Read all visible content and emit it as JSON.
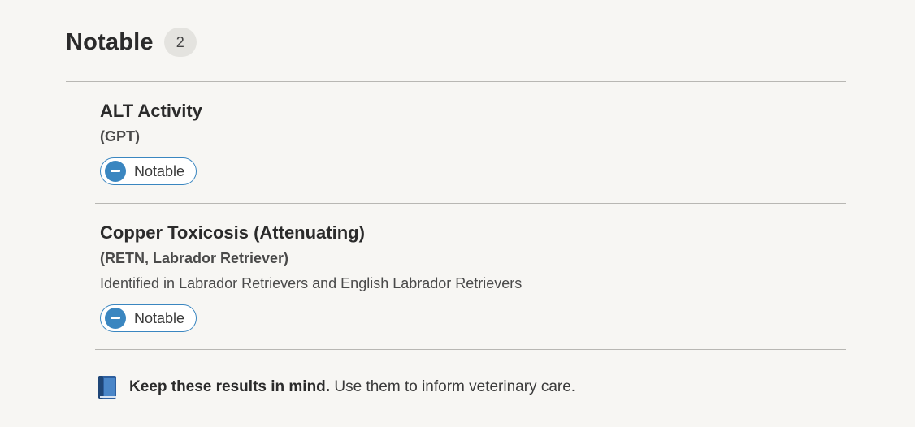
{
  "section": {
    "title": "Notable",
    "count": "2"
  },
  "results": [
    {
      "title": "ALT Activity",
      "subtitle": "(GPT)",
      "status_label": "Notable",
      "status_icon": "minus-circle-icon"
    },
    {
      "title": "Copper Toxicosis (Attenuating)",
      "subtitle": "(RETN, Labrador Retriever)",
      "description": "Identified in Labrador Retrievers and English Labrador Retrievers",
      "status_label": "Notable",
      "status_icon": "minus-circle-icon"
    }
  ],
  "footer": {
    "icon": "book-icon",
    "bold_text": "Keep these results in mind.",
    "text": " Use them to inform veterinary care."
  },
  "colors": {
    "accent": "#3a86c0",
    "background": "#f7f6f3",
    "badge": "#e4e3df"
  }
}
